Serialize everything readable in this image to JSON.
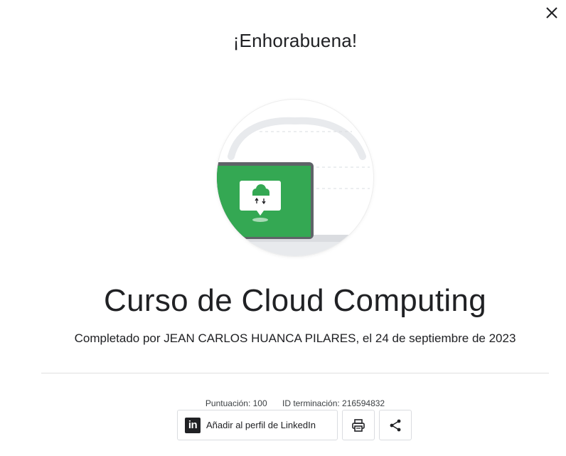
{
  "dialog": {
    "close_label": "×",
    "heading": "¡Enhorabuena!",
    "course_title": "Curso de Cloud Computing",
    "completed_text": "Completado por JEAN CARLOS HUANCA PILARES, el 24 de septiembre de 2023"
  },
  "meta": {
    "score": "Puntuación: 100",
    "completion_id": "ID terminación: 216594832"
  },
  "actions": {
    "linkedin_logo": "in",
    "linkedin_label": "Añadir al perfil de LinkedIn",
    "print_icon": "printer-icon",
    "share_icon": "share-icon"
  },
  "colors": {
    "badge_green": "#34A853",
    "laptop_frame": "#5F6368",
    "text_primary": "#202124"
  }
}
